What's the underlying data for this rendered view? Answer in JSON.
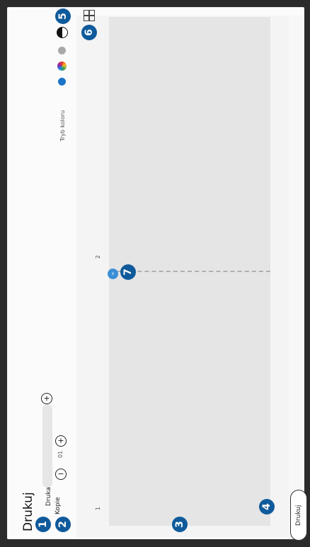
{
  "title": "Drukuj",
  "printer": {
    "label": "Drukarka",
    "add_symbol": "+"
  },
  "copies": {
    "label": "Kopie",
    "value": "01",
    "decrement": "−",
    "increment": "+"
  },
  "color_mode": {
    "label": "Tryb koloru"
  },
  "preview": {
    "page_numbers": [
      "1",
      "2"
    ]
  },
  "print_button": {
    "label": "Drukuj"
  },
  "badges": [
    "1",
    "2",
    "3",
    "4",
    "5",
    "6",
    "7"
  ],
  "accent_color": "#0f5a9b"
}
